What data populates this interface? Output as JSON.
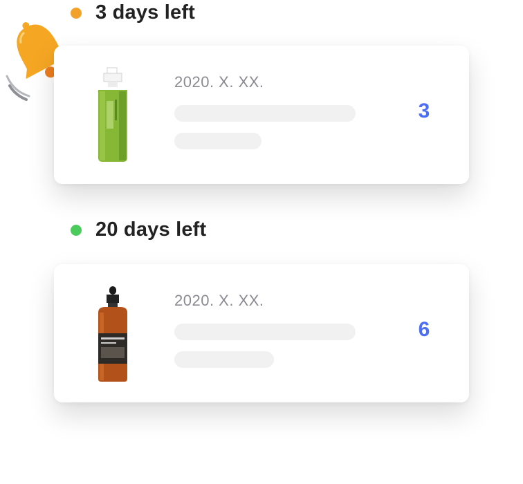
{
  "colors": {
    "orange": "#F2A22B",
    "green": "#4BCB5B",
    "accent": "#4C6EF5"
  },
  "icons": {
    "notification": "bell-icon"
  },
  "groups": [
    {
      "title": "3 days left",
      "status_color": "#F2A22B",
      "item": {
        "date": "2020. X. XX.",
        "count": "3",
        "product_image": "green-cleansing-oil-bottle"
      }
    },
    {
      "title": "20 days left",
      "status_color": "#4BCB5B",
      "item": {
        "date": "2020. X. XX.",
        "count": "6",
        "product_image": "amber-dropper-bottle"
      }
    }
  ]
}
